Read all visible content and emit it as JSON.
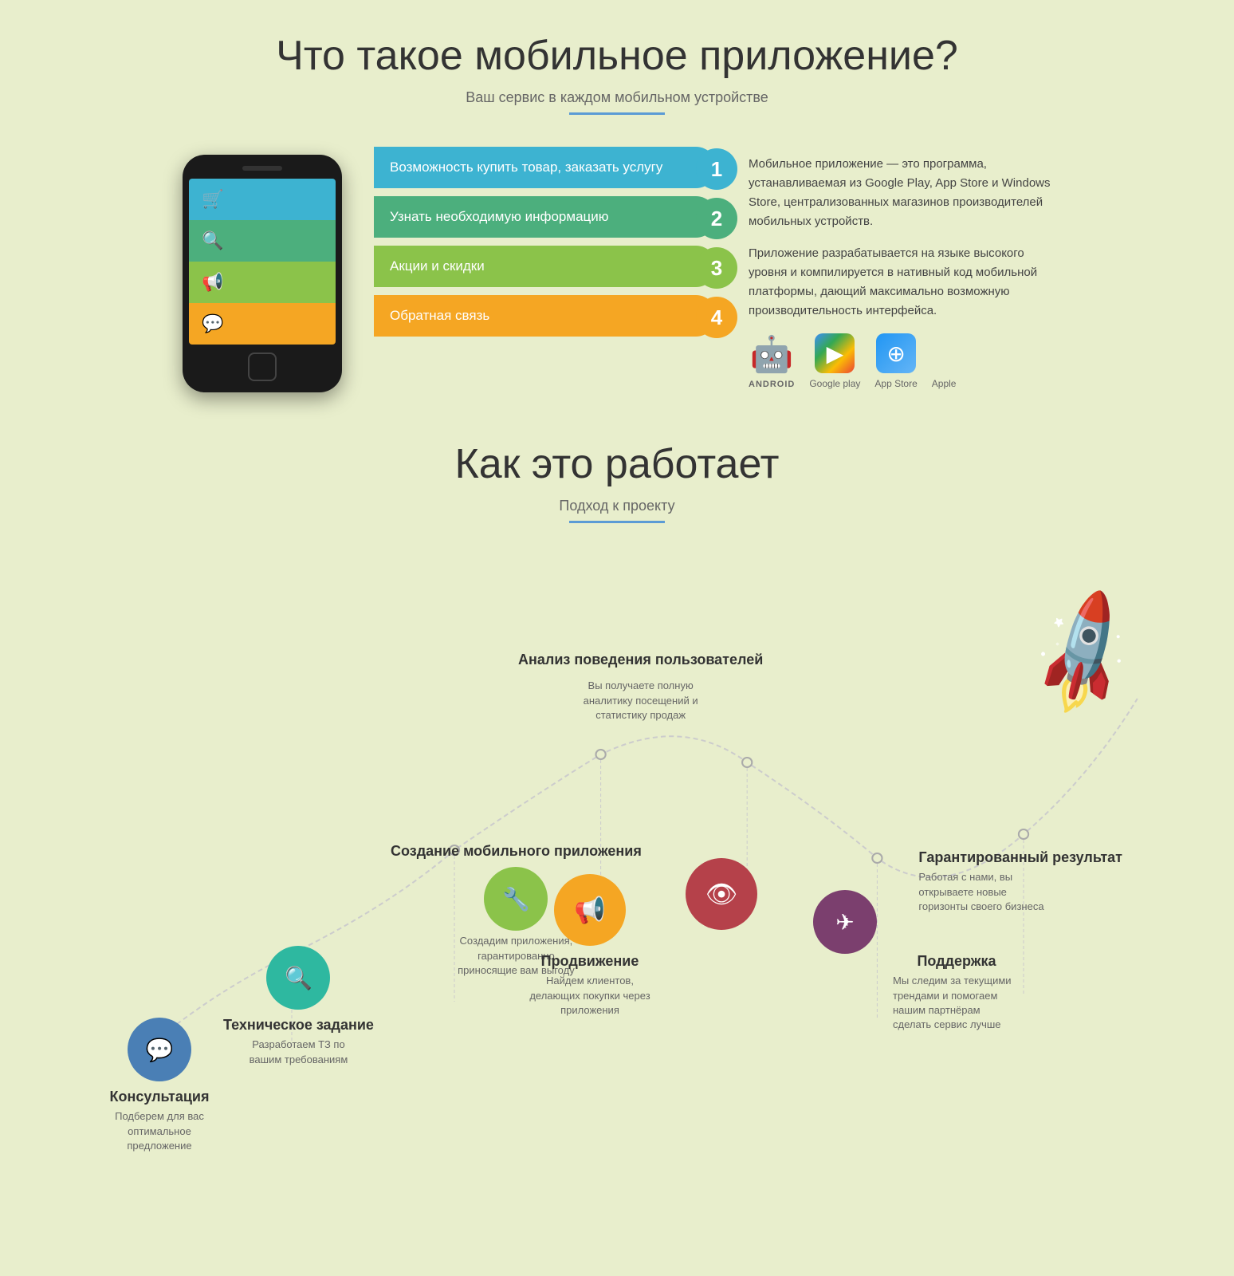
{
  "section1": {
    "main_title": "Что такое мобильное приложение?",
    "sub_title": "Ваш сервис в каждом мобильном устройстве",
    "description1": "Мобильное приложение — это программа, устанавливаемая из Google Play, App Store и Windows Store, централизованных магазинов производителей мобильных устройств.",
    "description2": "Приложение разрабатывается на языке высокого уровня и компилируется в нативный код мобильной платформы, дающий максимально возможную производительность интерфейса.",
    "features": [
      {
        "text": "Возможность купить товар, заказать услугу",
        "number": "1",
        "color": "#3db3d1"
      },
      {
        "text": "Узнать необходимую информацию",
        "number": "2",
        "color": "#4caf7d"
      },
      {
        "text": "Акции и скидки",
        "number": "3",
        "color": "#8bc34a"
      },
      {
        "text": "Обратная связь",
        "number": "4",
        "color": "#f5a623"
      }
    ],
    "phone_rows": [
      {
        "icon": "🛒",
        "label": ""
      },
      {
        "icon": "🔍",
        "label": ""
      },
      {
        "icon": "📢",
        "label": ""
      },
      {
        "icon": "💬",
        "label": ""
      }
    ],
    "stores": [
      {
        "label": "ANDROID",
        "icon": "🤖"
      },
      {
        "label": "Google play",
        "icon": "▶"
      },
      {
        "label": "App Store",
        "icon": "⊕"
      },
      {
        "label": "Apple",
        "icon": ""
      }
    ]
  },
  "section2": {
    "main_title": "Как это работает",
    "sub_title": "Подход к проекту",
    "nodes": [
      {
        "id": "consultation",
        "title": "Консультация",
        "desc": "Подберем для вас оптимальное предложение",
        "icon": "💬",
        "color": "#4a7fb5"
      },
      {
        "id": "tech",
        "title": "Техническое задание",
        "desc": "Разработаем ТЗ по вашим требованиям",
        "icon": "🔍",
        "color": "#2eb8a0"
      },
      {
        "id": "creation",
        "title": "Создание мобильного приложения",
        "desc": "Создадим приложения, гарантированно приносящие вам выгоду",
        "icon": "🔧",
        "color": "#8bc34a"
      },
      {
        "id": "promotion",
        "title": "Продвижение",
        "desc": "Найдем клиентов, делающих покупки через приложения",
        "icon": "📢",
        "color": "#f5a623"
      },
      {
        "id": "analysis",
        "title": "Анализ поведения пользователей",
        "desc": "Вы получаете полную аналитику посещений и статистику продаж",
        "icon": "👁",
        "color": "#b5414a"
      },
      {
        "id": "support",
        "title": "Поддержка",
        "desc": "Мы следим за текущими трендами и помогаем нашим партнёрам сделать сервис лучше",
        "icon": "✈",
        "color": "#7b3f6e"
      },
      {
        "id": "result",
        "title": "Гарантированный результат",
        "desc": "Работая с нами, вы открываете новые горизонты своего бизнеса",
        "icon": "🚀",
        "color": "#888"
      }
    ]
  }
}
